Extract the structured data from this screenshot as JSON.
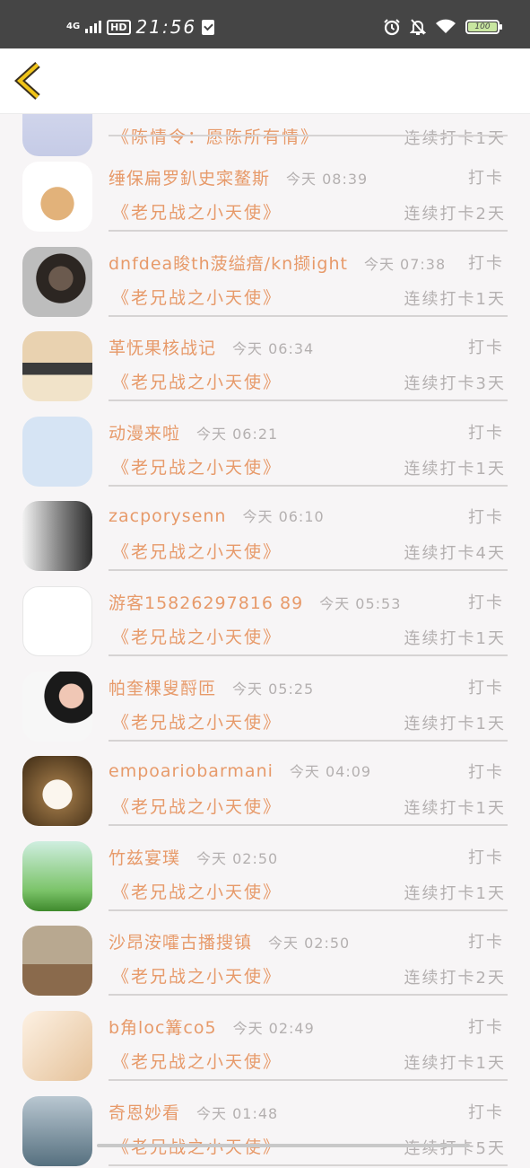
{
  "status_bar": {
    "network": "4G",
    "hd": "HD",
    "time": "21:56",
    "battery": "100",
    "icons": [
      "alarm-icon",
      "mute-bell-icon",
      "wifi-icon",
      "battery-icon"
    ]
  },
  "header": {
    "back_icon": "chevron-left-icon"
  },
  "top_partial": {
    "book": "《陈情令：愿陈所有情》",
    "streak": "连续打卡1天"
  },
  "rows": [
    {
      "name": "缍保扁罗釟史寀鳌斯",
      "time": "今天 08:39",
      "punch": "打卡",
      "book": "《老兄战之小天使》",
      "streak": "连续打卡2天",
      "avatar": "cartoon-avatar"
    },
    {
      "name": "dnfdea睃th菠缢瘖/kn撷ight",
      "time": "今天 07:38",
      "punch": "打卡",
      "book": "《老兄战之小天使》",
      "streak": "连续打卡1天",
      "avatar": "man-portrait-avatar"
    },
    {
      "name": "革怃果核战记",
      "time": "今天 06:34",
      "punch": "打卡",
      "book": "《老兄战之小天使》",
      "streak": "连续打卡3天",
      "avatar": "camera-avatar"
    },
    {
      "name": "动漫来啦",
      "time": "今天 06:21",
      "punch": "打卡",
      "book": "《老兄战之小天使》",
      "streak": "连续打卡1天",
      "avatar": "qq-star-avatar"
    },
    {
      "name": "zacporysenn",
      "time": "今天 06:10",
      "punch": "打卡",
      "book": "《老兄战之小天使》",
      "streak": "连续打卡4天",
      "avatar": "couple-avatar"
    },
    {
      "name": "游客15826297816 89",
      "time": "今天 05:53",
      "punch": "打卡",
      "book": "《老兄战之小天使》",
      "streak": "连续打卡1天",
      "avatar": "sketch-girl-avatar"
    },
    {
      "name": "帕奎棵叟酹匝",
      "time": "今天 05:25",
      "punch": "打卡",
      "book": "《老兄战之小天使》",
      "streak": "连续打卡1天",
      "avatar": "woman-avatar"
    },
    {
      "name": "empoariobarmani",
      "time": "今天 04:09",
      "punch": "打卡",
      "book": "《老兄战之小天使》",
      "streak": "连续打卡1天",
      "avatar": "rabbit-avatar"
    },
    {
      "name": "竹兹宴璞",
      "time": "今天 02:50",
      "punch": "打卡",
      "book": "《老兄战之小天使》",
      "streak": "连续打卡1天",
      "avatar": "dandelion-avatar"
    },
    {
      "name": "沙昂洝嚯古播搜镇",
      "time": "今天 02:50",
      "punch": "打卡",
      "book": "《老兄战之小天使》",
      "streak": "连续打卡2天",
      "avatar": "flower-vase-avatar"
    },
    {
      "name": "b角loc篝co5",
      "time": "今天 02:49",
      "punch": "打卡",
      "book": "《老兄战之小天使》",
      "streak": "连续打卡1天",
      "avatar": "love-you-avatar"
    },
    {
      "name": "奇恩妙看",
      "time": "今天 01:48",
      "punch": "打卡",
      "book": "《老兄战之小天使》",
      "streak": "连续打卡5天",
      "avatar": "misty-avatar"
    }
  ]
}
